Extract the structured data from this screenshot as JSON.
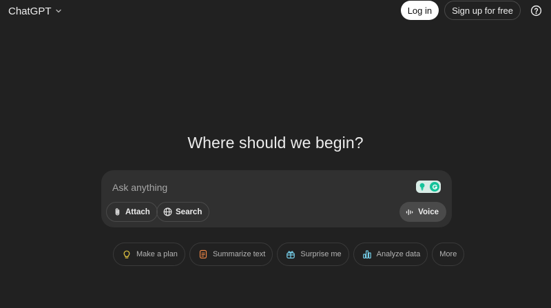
{
  "header": {
    "brand": "ChatGPT",
    "login_label": "Log in",
    "signup_label": "Sign up for free",
    "help_icon": "question-circle-icon"
  },
  "main": {
    "title": "Where should we begin?"
  },
  "composer": {
    "placeholder": "Ask anything",
    "value": "",
    "attach_label": "Attach",
    "search_label": "Search",
    "voice_label": "Voice"
  },
  "suggestions": [
    {
      "label": "Make a plan",
      "icon": "lightbulb-icon",
      "color": "#e2c541"
    },
    {
      "label": "Summarize text",
      "icon": "document-icon",
      "color": "#ea8444"
    },
    {
      "label": "Surprise me",
      "icon": "gift-icon",
      "color": "#76d0eb"
    },
    {
      "label": "Analyze data",
      "icon": "bar-chart-icon",
      "color": "#76d0eb"
    },
    {
      "label": "More",
      "icon": "",
      "color": ""
    }
  ],
  "colors": {
    "background": "#212121",
    "composer": "#303030",
    "text": "#ececec",
    "muted": "#b4b4b4",
    "grammarly": "#15c39a"
  }
}
